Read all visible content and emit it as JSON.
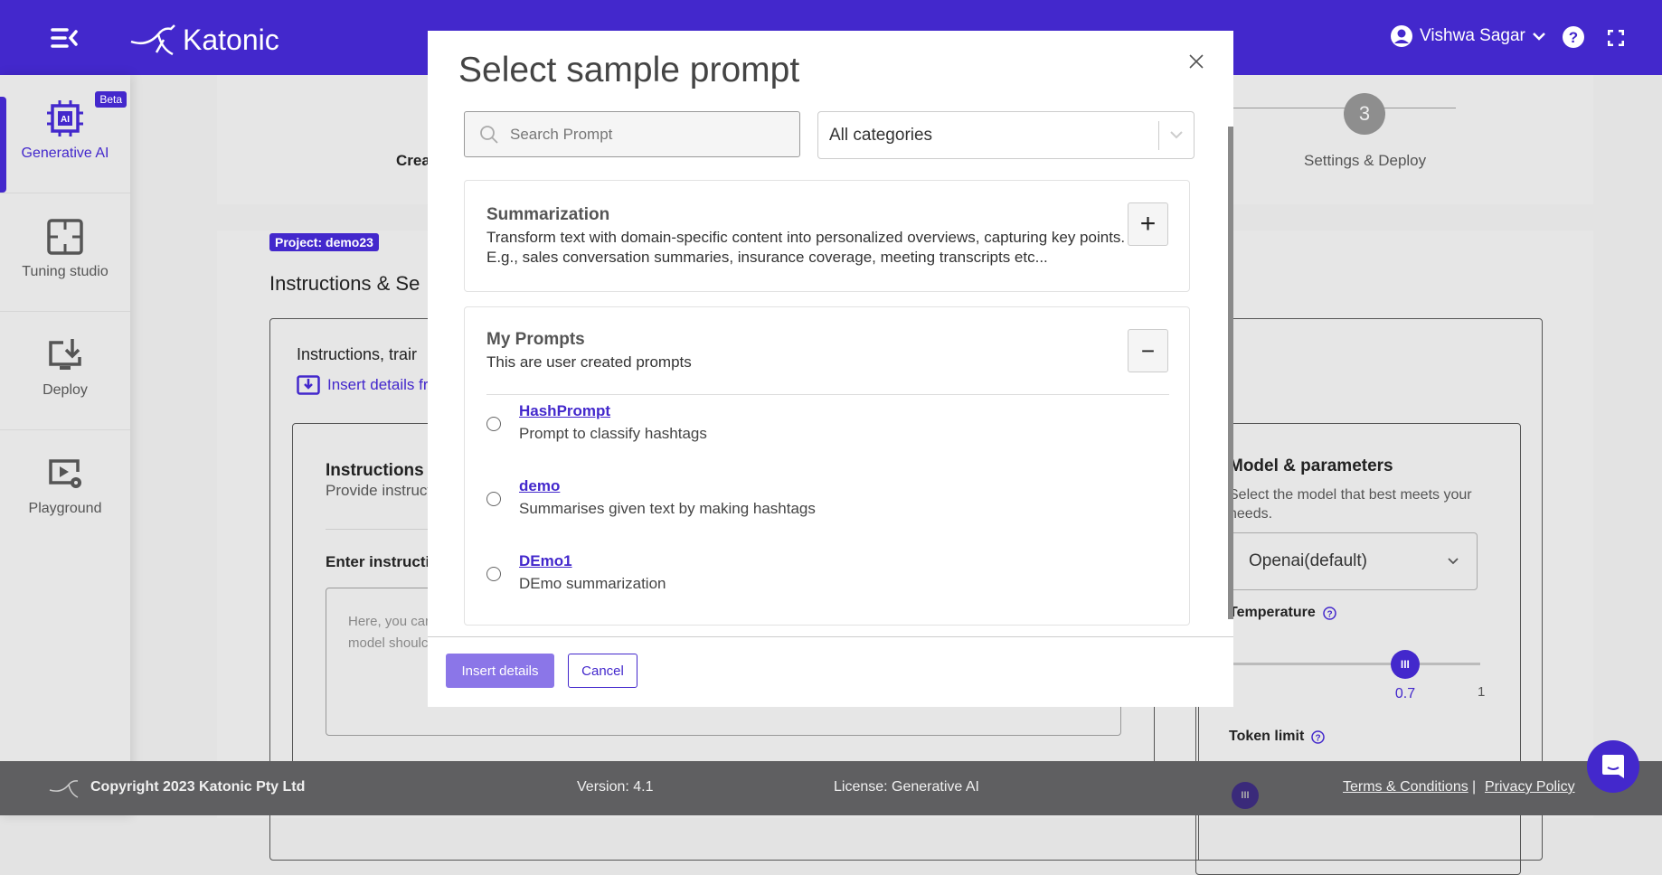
{
  "header": {
    "brand": "Katonic",
    "user": "Vishwa Sagar",
    "color": "#4328cc",
    "icons": [
      "menu-collapse-icon",
      "user-circle-icon",
      "chevron-down-icon",
      "help-icon",
      "fullscreen-icon"
    ]
  },
  "sidebar": {
    "items": [
      {
        "label": "Generative AI",
        "badge": "Beta",
        "active": true
      },
      {
        "label": "Tuning studio"
      },
      {
        "label": "Deploy"
      },
      {
        "label": "Playground"
      }
    ]
  },
  "background": {
    "stepper": {
      "step1_label": "Crea",
      "step3_number": "3",
      "step3_label": "Settings & Deploy"
    },
    "project_badge": "Project: demo23",
    "section_title": "Instructions & Se",
    "instructions_title": "Instructions, trair",
    "insert_link": "Insert details fr",
    "instructions_heading": "Instructions",
    "instructions_sub": "Provide instruct",
    "enter_label": "Enter instructio",
    "textarea_text": "Here, you car model shoulc",
    "model": {
      "title": "Model & parameters",
      "desc": "Select the model that best meets your needs.",
      "selected": "Openai(default)",
      "temperature_label": "Temperature",
      "temperature_value": 0.7,
      "temperature_min": "0",
      "temperature_max": "1",
      "token_label": "Token limit"
    }
  },
  "modal": {
    "title": "Select sample prompt",
    "search_placeholder": "Search Prompt",
    "category_selected": "All categories",
    "categories": [
      {
        "title": "Summarization",
        "desc": "Transform text with domain-specific content into personalized overviews, capturing key points. E.g., sales conversation summaries, insurance coverage, meeting transcripts etc...",
        "expanded": false,
        "toggle": "+"
      },
      {
        "title": "My Prompts",
        "desc": "This are user created prompts",
        "expanded": true,
        "toggle": "−",
        "prompts": [
          {
            "name": "HashPrompt",
            "desc": "Prompt to classify hashtags"
          },
          {
            "name": "demo",
            "desc": "Summarises given text by making hashtags"
          },
          {
            "name": "DEmo1",
            "desc": "DEmo summarization"
          }
        ]
      }
    ],
    "insert_button": "Insert details",
    "cancel_button": "Cancel"
  },
  "footer": {
    "copyright": "Copyright 2023 Katonic Pty Ltd",
    "version": "Version: 4.1",
    "license": "License: Generative AI",
    "terms": "Terms & Conditions",
    "separator": "|",
    "privacy": "Privacy Policy"
  }
}
